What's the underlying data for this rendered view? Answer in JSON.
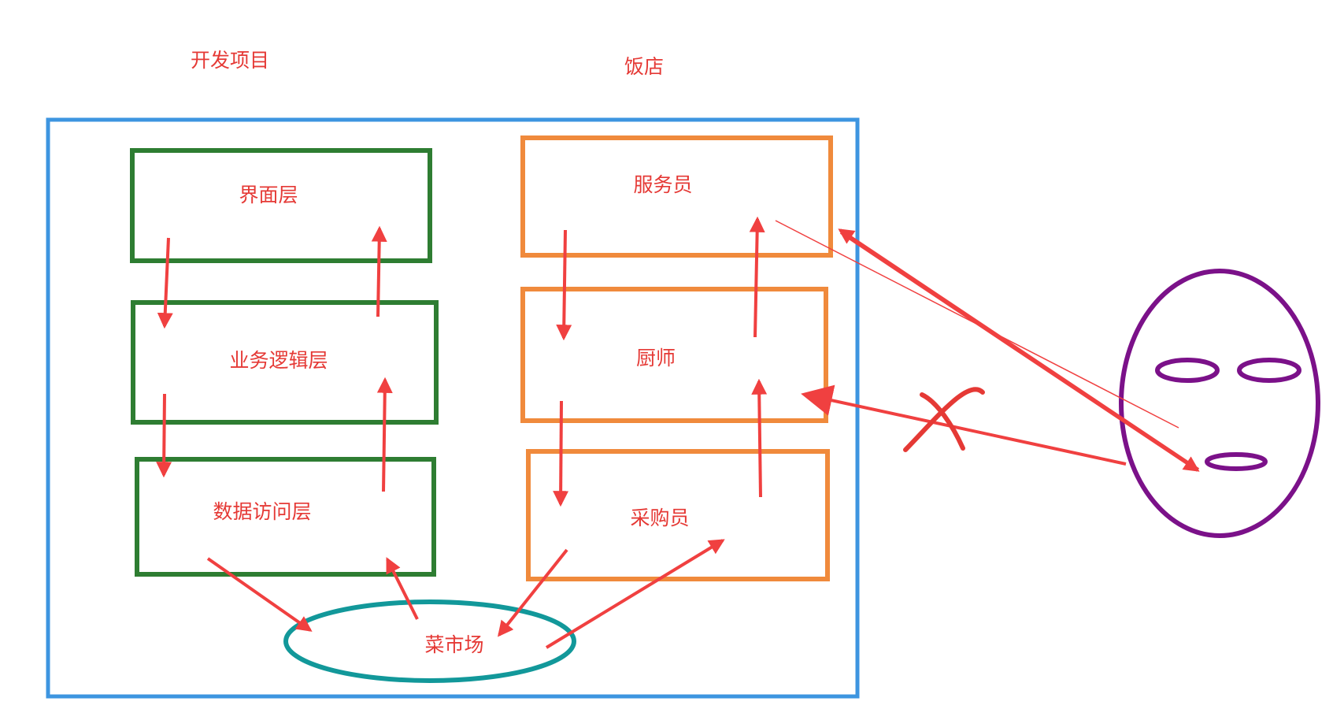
{
  "titles": {
    "project": "开发项目",
    "restaurant": "饭店"
  },
  "project_layers": {
    "ui": "界面层",
    "business": "业务逻辑层",
    "data_access": "数据访问层"
  },
  "restaurant_roles": {
    "waiter": "服务员",
    "chef": "厨师",
    "buyer": "采购员"
  },
  "market": "菜市场",
  "colors": {
    "text": "#e53935",
    "arrow": "#f04040",
    "outer_frame": "#3d95e0",
    "project_box": "#2e7d32",
    "restaurant_box": "#f08a3c",
    "market_ellipse": "#12989a",
    "face": "#7b1189",
    "cross": "#e53935"
  }
}
